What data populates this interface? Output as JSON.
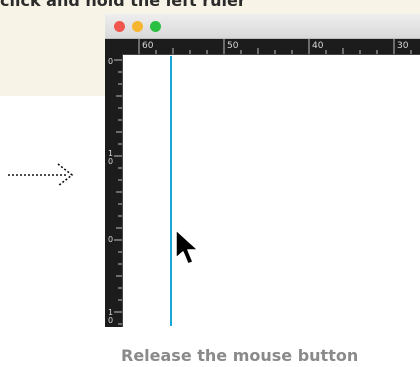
{
  "captions": {
    "top": "click and hold the left ruler",
    "bottom": "Release the mouse button"
  },
  "window": {
    "traffic_lights": [
      "close",
      "minimize",
      "maximize"
    ]
  },
  "rulers": {
    "horizontal_labels": [
      "60",
      "50",
      "40",
      "30"
    ],
    "vertical_labels": [
      "0",
      "10",
      "0",
      "10"
    ]
  },
  "icons": {
    "arrow": "dotted-arrow-right-icon",
    "cursor": "mouse-pointer-icon"
  },
  "colors": {
    "guide": "#1ba6d8",
    "ruler": "#1c1c1c",
    "banner": "#f7f3e6",
    "close": "#f0564e",
    "minimize": "#f6b632",
    "maximize": "#29c041"
  }
}
